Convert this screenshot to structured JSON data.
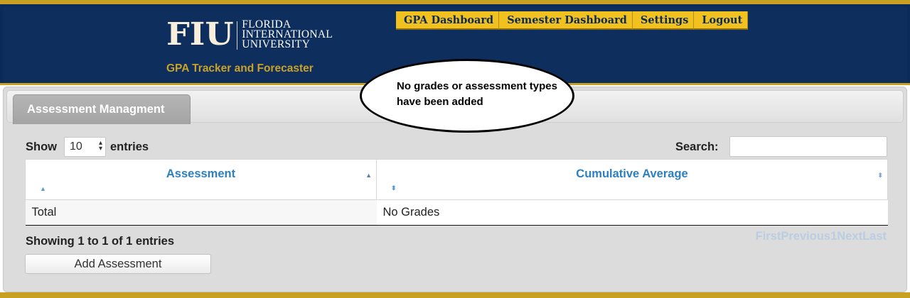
{
  "header": {
    "logo_mark": "FIU",
    "logo_line1": "FLORIDA",
    "logo_line2": "INTERNATIONAL",
    "logo_line3": "UNIVERSITY",
    "tagline": "GPA Tracker and Forecaster",
    "nav": [
      "GPA Dashboard",
      "Semester Dashboard",
      "Settings",
      "Logout"
    ]
  },
  "callout": {
    "text": "No grades or assessment types have been added"
  },
  "panel": {
    "tab_label": "Assessment Managment",
    "show_label": "Show",
    "page_length": "10",
    "entries_label": "entries",
    "search_label": "Search:",
    "search_value": "",
    "columns": [
      "Assessment",
      "Cumulative Average"
    ],
    "rows": [
      [
        "Total",
        "No Grades"
      ]
    ],
    "info": "Showing 1 to 1 of 1 entries",
    "pager": [
      "First",
      "Previous",
      "1",
      "Next",
      "Last"
    ],
    "add_button": "Add Assessment"
  },
  "colors": {
    "navy": "#0e2e5e",
    "gold": "#c8a022",
    "nav_gold": "#f0c11f",
    "link_blue": "#2c7fc1"
  }
}
